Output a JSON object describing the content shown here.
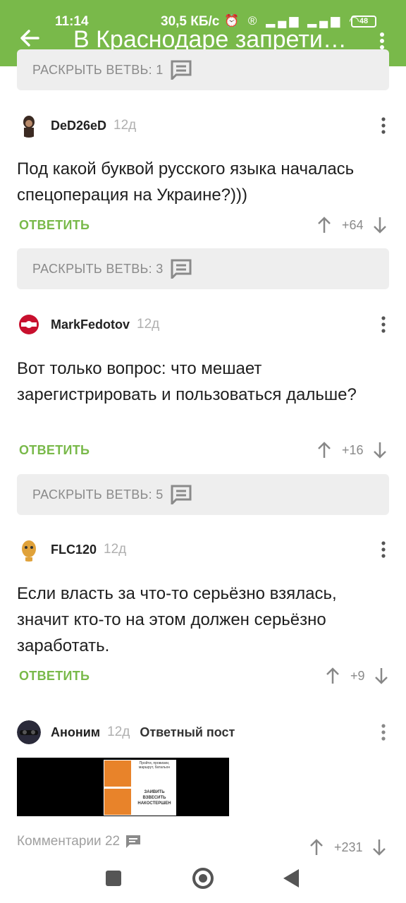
{
  "status_bar": {
    "time": "11:14",
    "speed": "30,5 КБ/с",
    "battery": "48"
  },
  "header": {
    "title": "В Краснодаре запретил..."
  },
  "expand_top": {
    "label": "РАСКРЫТЬ ВЕТВЬ: 1"
  },
  "comments": [
    {
      "user": "DeD26eD",
      "age": "12д",
      "text": "Под какой буквой русского языка началась спецоперация на Украине?)))",
      "reply": "ОТВЕТИТЬ",
      "score": "+64",
      "expand": "РАСКРЫТЬ ВЕТВЬ: 3"
    },
    {
      "user": "MarkFedotov",
      "age": "12д",
      "text": "Вот только вопрос: что мешает зарегистрировать и пользоваться дальше?",
      "reply": "ОТВЕТИТЬ",
      "score": "+16",
      "expand": "РАСКРЫТЬ ВЕТВЬ: 5"
    },
    {
      "user": "FLC120",
      "age": "12д",
      "text": "Если власть за что-то серьёзно взялась, значит кто-то на этом должен серьёзно заработать.",
      "reply": "ОТВЕТИТЬ",
      "score": "+9"
    }
  ],
  "post": {
    "user": "Аноним",
    "age": "12д",
    "tag": "Ответный пост",
    "meme_top": "Пройти, провизии, маршрут, батальон",
    "meme_bottom": "ЗАИВИТЬ ВЗВЕСИТЬ НАКОСТЕРШЕН"
  },
  "footer": {
    "comments_label": "Комментарии 22",
    "score": "+231"
  },
  "colors": {
    "accent": "#79b94a",
    "text": "#1e1e1e",
    "muted": "#8a8a8a",
    "bar": "#eeeeee"
  }
}
